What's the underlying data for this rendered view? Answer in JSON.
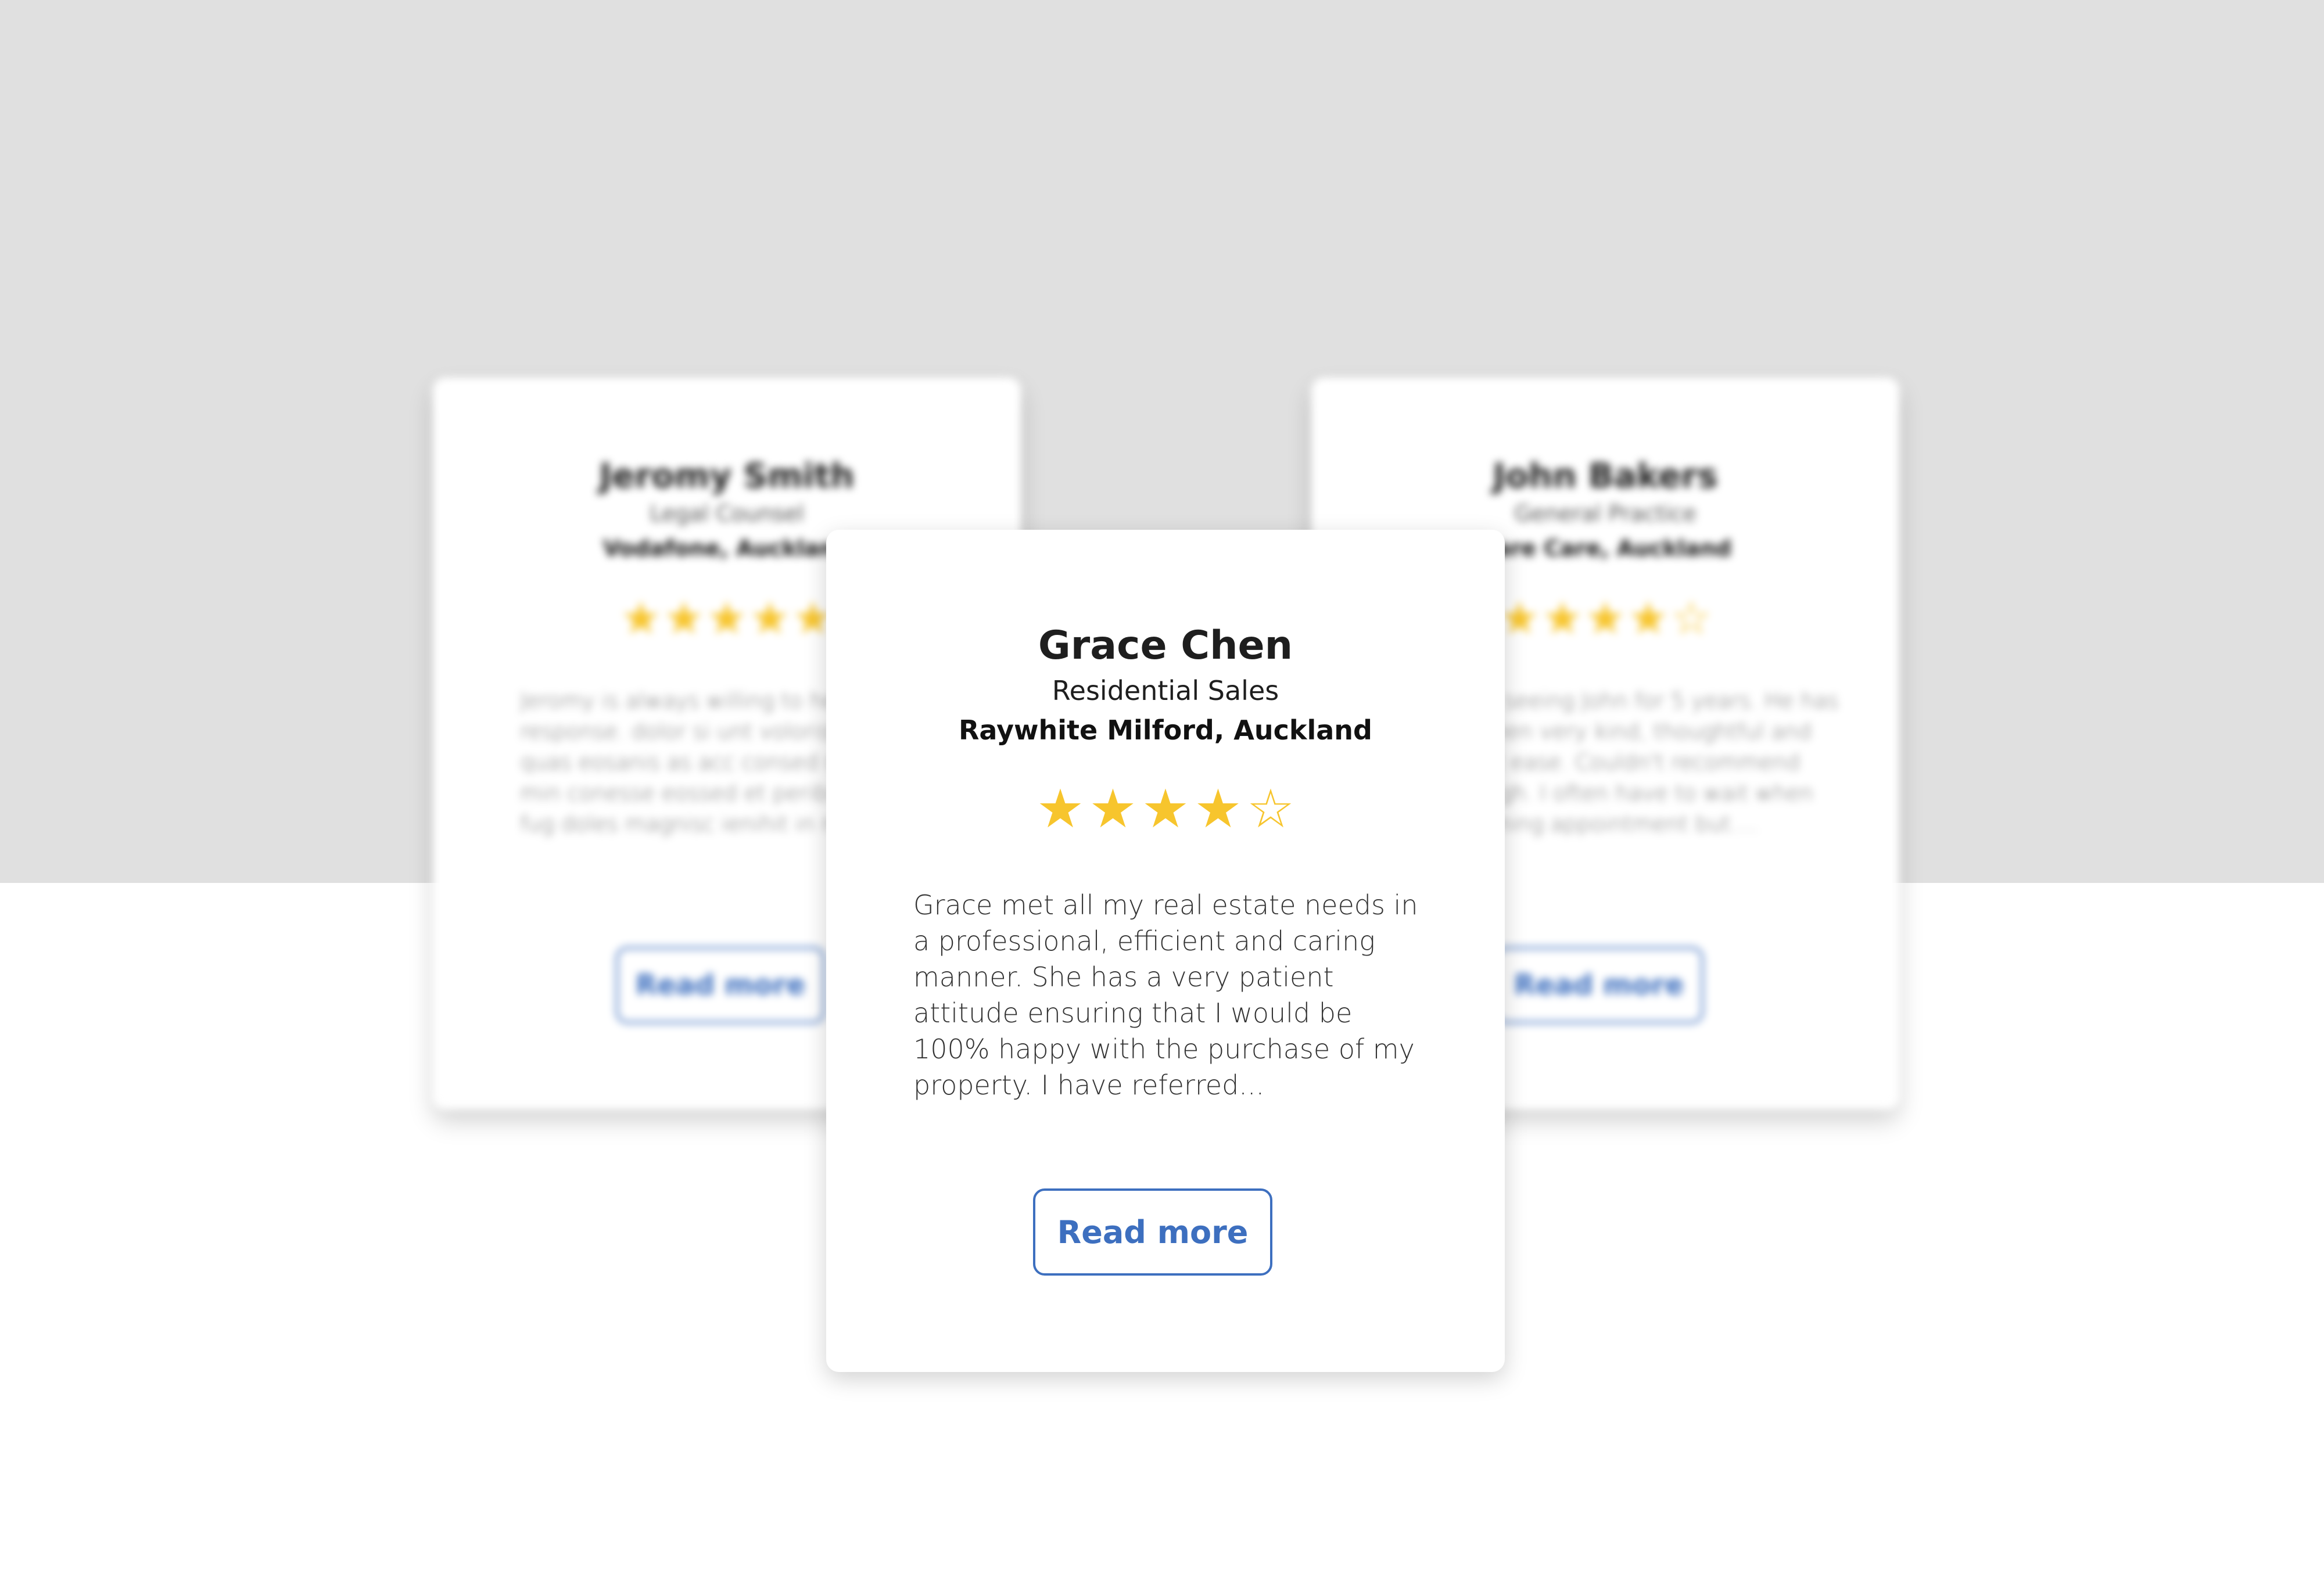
{
  "colors": {
    "background_top": "#e0e0e0",
    "background_bottom": "#ffffff",
    "star": "#f7c52d",
    "button_accent": "#3d6fbf"
  },
  "icons": {
    "star_filled": "★",
    "star_empty": "☆"
  },
  "cards": [
    {
      "name": "Jeromy Smith",
      "role": "Legal Counsel",
      "company": "Vodafone, Auckland",
      "rating": 5,
      "rating_max": 5,
      "text": "Jeromy is always willing to help response. dolor si unt volorist sinverum quas eosanis as acc consed maximaio min conesse eossed et peribuste nonet fug doles magnisc ienihit in nis. ...",
      "button_label": "Read more"
    },
    {
      "name": "Grace Chen",
      "role": "Residential Sales",
      "company": "Raywhite Milford, Auckland",
      "rating": 4,
      "rating_max": 5,
      "text": "Grace met all my real estate needs in a professional, efficient and caring manner. She has a very patient attitude ensuring that I would be 100% happy with the purchase of my property. I have referred...",
      "button_label": "Read more"
    },
    {
      "name": "John Bakers",
      "role": "General Practice",
      "company": "Care Care, Auckland",
      "rating": 4,
      "rating_max": 5,
      "text": "I've been seeing John for 5 years. He has always been very kind, thoughtful and put me at ease. Couldn't recommend him enough. I often have to wait when for a morning appointment but....",
      "button_label": "Read more"
    }
  ]
}
